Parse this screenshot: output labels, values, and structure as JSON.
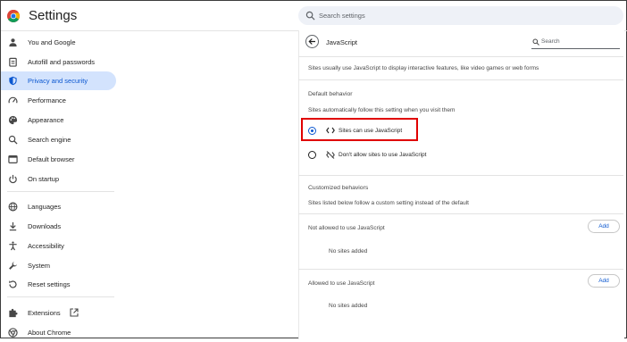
{
  "app": {
    "title": "Settings",
    "search_placeholder": "Search settings"
  },
  "sidebar": {
    "items": [
      {
        "label": "You and Google",
        "icon": "person-icon"
      },
      {
        "label": "Autofill and passwords",
        "icon": "clipboard-icon"
      },
      {
        "label": "Privacy and security",
        "icon": "shield-icon",
        "active": true
      },
      {
        "label": "Performance",
        "icon": "speedometer-icon"
      },
      {
        "label": "Appearance",
        "icon": "palette-icon"
      },
      {
        "label": "Search engine",
        "icon": "search-icon"
      },
      {
        "label": "Default browser",
        "icon": "browser-icon"
      },
      {
        "label": "On startup",
        "icon": "power-icon"
      },
      {
        "label": "Languages",
        "icon": "globe-icon"
      },
      {
        "label": "Downloads",
        "icon": "download-icon"
      },
      {
        "label": "Accessibility",
        "icon": "accessibility-icon"
      },
      {
        "label": "System",
        "icon": "wrench-icon"
      },
      {
        "label": "Reset settings",
        "icon": "reset-icon"
      },
      {
        "label": "Extensions",
        "icon": "puzzle-icon"
      },
      {
        "label": "About Chrome",
        "icon": "chrome-icon"
      }
    ]
  },
  "page": {
    "title": "JavaScript",
    "search_placeholder": "Search",
    "description": "Sites usually use JavaScript to display interactive features, like video games or web forms",
    "default_behavior": {
      "heading": "Default behavior",
      "subheading": "Sites automatically follow this setting when you visit them",
      "options": [
        {
          "label": "Sites can use JavaScript",
          "icon": "code-icon",
          "selected": true
        },
        {
          "label": "Don't allow sites to use JavaScript",
          "icon": "code-off-icon",
          "selected": false
        }
      ]
    },
    "customized": {
      "heading": "Customized behaviors",
      "subheading": "Sites listed below follow a custom setting instead of the default",
      "not_allowed": {
        "label": "Not allowed to use JavaScript",
        "add": "Add",
        "empty": "No sites added"
      },
      "allowed": {
        "label": "Allowed to use JavaScript",
        "add": "Add",
        "empty": "No sites added"
      }
    }
  },
  "colors": {
    "accent": "#0b57d0",
    "active_bg": "#d3e3fd",
    "highlight": "#e00000"
  }
}
